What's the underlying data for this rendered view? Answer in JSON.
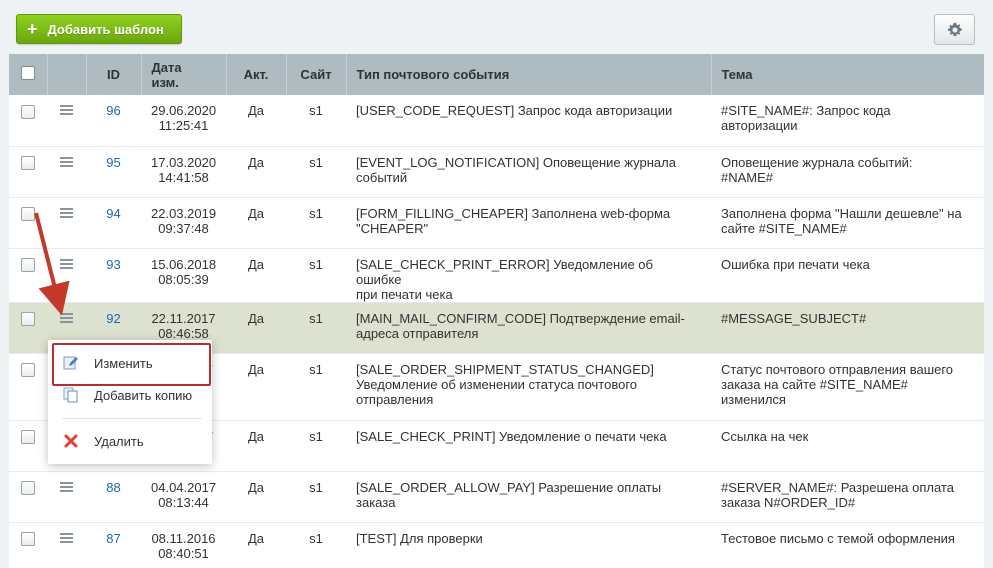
{
  "toolbar": {
    "add_template_label": "Добавить шаблон",
    "add_icon": "plus-icon",
    "settings_icon": "gear-icon"
  },
  "table": {
    "columns": {
      "id": "ID",
      "date_line1": "Дата",
      "date_line2": "изм.",
      "active": "Акт.",
      "site": "Сайт",
      "event_type": "Тип почтового события",
      "subject": "Тема"
    },
    "rows": [
      {
        "id": "96",
        "date": "29.06.2020",
        "time": "11:25:41",
        "active": "Да",
        "site": "s1",
        "event": [
          "[USER_CODE_REQUEST] Запрос кода авторизации",
          ""
        ],
        "subject": [
          "#SITE_NAME#: Запрос кода",
          "авторизации"
        ]
      },
      {
        "id": "95",
        "date": "17.03.2020",
        "time": "14:41:58",
        "active": "Да",
        "site": "s1",
        "event": [
          "[EVENT_LOG_NOTIFICATION] Оповещение журнала",
          "событий"
        ],
        "subject": [
          "Оповещение журнала событий:",
          "#NAME#"
        ]
      },
      {
        "id": "94",
        "date": "22.03.2019",
        "time": "09:37:48",
        "active": "Да",
        "site": "s1",
        "event": [
          "[FORM_FILLING_CHEAPER] Заполнена web-форма",
          "\"CHEAPER\""
        ],
        "subject": [
          "Заполнена форма \"Нашли дешевле\" на",
          "сайте #SITE_NAME#"
        ]
      },
      {
        "id": "93",
        "date": "15.06.2018",
        "time": "08:05:39",
        "active": "Да",
        "site": "s1",
        "event": [
          "[SALE_CHECK_PRINT_ERROR] Уведомление об ошибке",
          "при печати чека"
        ],
        "subject": [
          "Ошибка при печати чека",
          ""
        ]
      },
      {
        "id": "92",
        "date": "22.11.2017",
        "time": "08:46:58",
        "active": "Да",
        "site": "s1",
        "event": [
          "[MAIN_MAIL_CONFIRM_CODE] Подтверждение email-",
          "адреса отправителя"
        ],
        "subject": [
          "#MESSAGE_SUBJECT#",
          ""
        ]
      },
      {
        "id": "",
        "date": "",
        "time": "",
        "active": "Да",
        "site": "s1",
        "event": [
          "[SALE_ORDER_SHIPMENT_STATUS_CHANGED]",
          "Уведомление об изменении статуса почтового",
          "отправления"
        ],
        "subject": [
          "Статус почтового отправления вашего",
          "заказа на сайте #SITE_NAME#",
          "изменился"
        ]
      },
      {
        "id": "",
        "date": "",
        "time": "",
        "active": "Да",
        "site": "s1",
        "event": [
          "[SALE_CHECK_PRINT] Уведомление о печати чека",
          ""
        ],
        "subject": [
          "Ссылка на чек",
          ""
        ]
      },
      {
        "id": "88",
        "date": "04.04.2017",
        "time": "08:13:44",
        "active": "Да",
        "site": "s1",
        "event": [
          "[SALE_ORDER_ALLOW_PAY] Разрешение оплаты заказа",
          ""
        ],
        "subject": [
          "#SERVER_NAME#: Разрешена оплата",
          "заказа N#ORDER_ID#"
        ]
      },
      {
        "id": "87",
        "date": "08.11.2016",
        "time": "08:40:51",
        "active": "Да",
        "site": "s1",
        "event": [
          "[TEST] Для проверки",
          ""
        ],
        "subject": [
          "Тестовое письмо с темой оформления",
          ""
        ]
      }
    ],
    "partial_tail": {
      "row6": "7",
      "row7": "7"
    }
  },
  "context_menu": {
    "items": [
      {
        "label": "Изменить",
        "icon": "edit-icon"
      },
      {
        "label": "Добавить копию",
        "icon": "copy-icon"
      },
      {
        "label": "Удалить",
        "icon": "delete-icon"
      }
    ]
  },
  "colors": {
    "accent_green": "#7bbd16",
    "highlight_row": "#dde1cf",
    "annotation_red": "#b0312f",
    "link_blue": "#2067b0"
  }
}
